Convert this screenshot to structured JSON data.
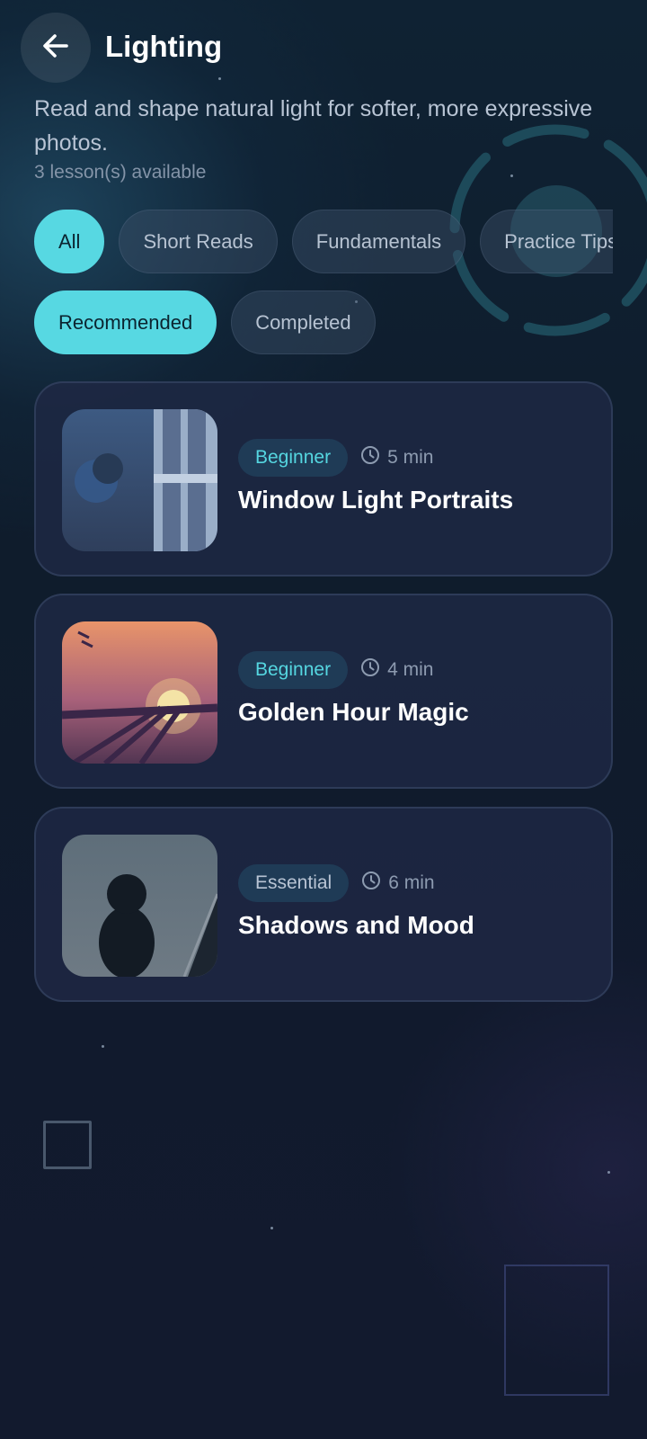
{
  "header": {
    "title": "Lighting",
    "subtitle": "Read and shape natural light for softer, more expressive photos.",
    "count_text": "3 lesson(s) available"
  },
  "filters": {
    "category": [
      {
        "label": "All",
        "active": true
      },
      {
        "label": "Short Reads",
        "active": false
      },
      {
        "label": "Fundamentals",
        "active": false
      },
      {
        "label": "Practice Tips",
        "active": false
      }
    ],
    "status": [
      {
        "label": "Recommended",
        "active": true
      },
      {
        "label": "Completed",
        "active": false
      }
    ]
  },
  "lessons": [
    {
      "level": "Beginner",
      "duration": "5 min",
      "title": "Window Light Portraits",
      "thumbnail": "window-light-illustration"
    },
    {
      "level": "Beginner",
      "duration": "4 min",
      "title": "Golden Hour Magic",
      "thumbnail": "golden-hour-illustration"
    },
    {
      "level": "Essential",
      "duration": "6 min",
      "title": "Shadows and Mood",
      "thumbnail": "shadow-figure-illustration"
    }
  ],
  "icons": {
    "back": "arrow-left-icon",
    "duration": "clock-icon"
  },
  "colors": {
    "accent": "#57d8e2",
    "card": "#1e2844",
    "background": "#0f1c2c"
  }
}
